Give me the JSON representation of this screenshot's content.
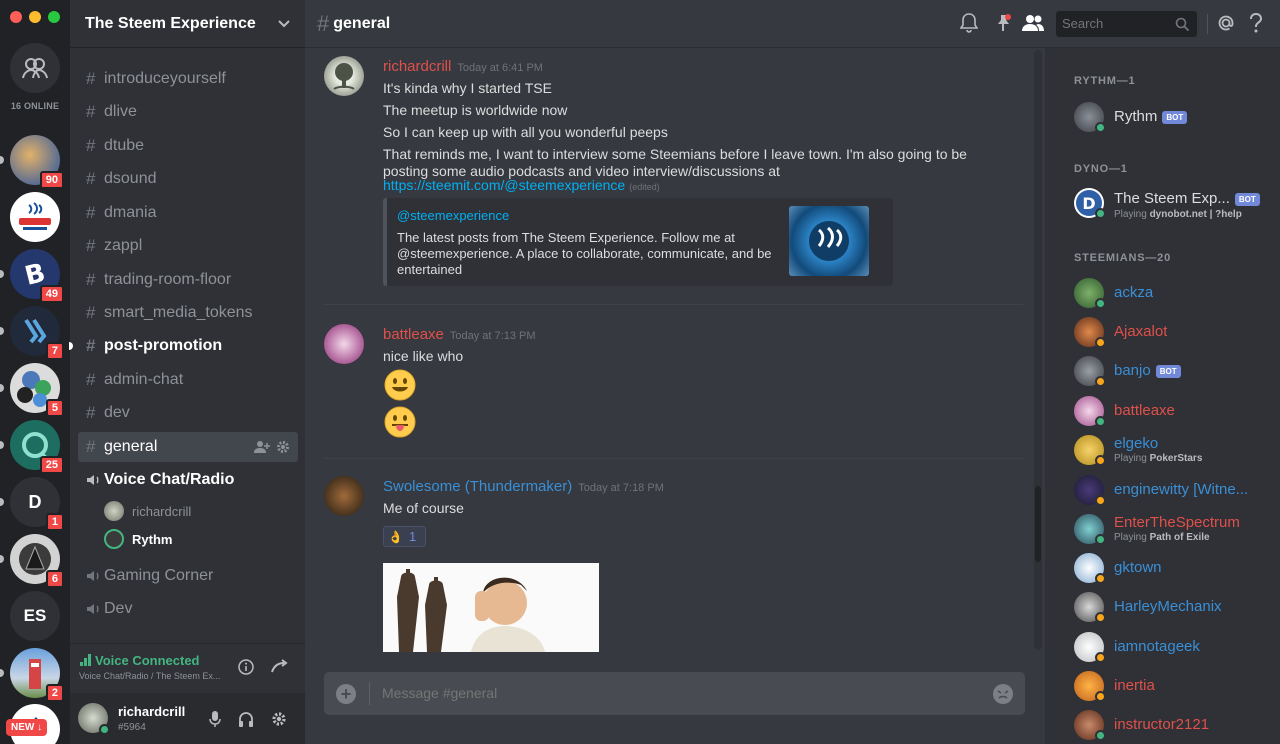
{
  "window": {
    "traffic_colors": [
      "#ff5f57",
      "#febc2e",
      "#28c840"
    ]
  },
  "guild_bar": {
    "online_count": "16 ONLINE",
    "guilds": [
      {
        "name": "server-1",
        "badge": "90",
        "color": "#6a7a9a"
      },
      {
        "name": "steemit-meetup",
        "badge": "",
        "color": "#ffffff"
      },
      {
        "name": "bitcoin",
        "badge": "49",
        "color": "#2a3f8f"
      },
      {
        "name": "bittrex",
        "badge": "7",
        "color": "#3a5d8c"
      },
      {
        "name": "crypto-mix",
        "badge": "5",
        "color": "#d9d9d9"
      },
      {
        "name": "teal-circle",
        "badge": "25",
        "color": "#1e7a6a"
      },
      {
        "name": "D",
        "badge": "1",
        "initials": "D",
        "color": "#2f3136"
      },
      {
        "name": "pyramid",
        "badge": "6",
        "color": "#cfcfcf"
      },
      {
        "name": "ES",
        "badge": "",
        "initials": "ES",
        "color": "#2f3136"
      },
      {
        "name": "blue-tower",
        "badge": "2",
        "color": "#4a7fc0"
      },
      {
        "name": "steem-new",
        "badge": "",
        "color": "#ffffff"
      }
    ],
    "new_label": "NEW ↓"
  },
  "server": {
    "name": "The Steem Experience"
  },
  "channels": [
    {
      "name": "introduceyourself",
      "state": "normal"
    },
    {
      "name": "dlive",
      "state": "normal"
    },
    {
      "name": "dtube",
      "state": "normal"
    },
    {
      "name": "dsound",
      "state": "normal"
    },
    {
      "name": "dmania",
      "state": "normal"
    },
    {
      "name": "zappl",
      "state": "normal"
    },
    {
      "name": "trading-room-floor",
      "state": "normal"
    },
    {
      "name": "smart_media_tokens",
      "state": "normal"
    },
    {
      "name": "post-promotion",
      "state": "unread"
    },
    {
      "name": "admin-chat",
      "state": "locked"
    },
    {
      "name": "dev",
      "state": "normal"
    },
    {
      "name": "general",
      "state": "active"
    }
  ],
  "voice_channels": [
    {
      "name": "Voice Chat/Radio",
      "state": "active",
      "users": [
        "richardcrill",
        "Rythm"
      ]
    },
    {
      "name": "Gaming Corner",
      "state": "normal"
    },
    {
      "name": "Dev",
      "state": "normal"
    }
  ],
  "voice_status": {
    "label": "Voice Connected",
    "sub": "Voice Chat/Radio / The Steem Ex..."
  },
  "user": {
    "name": "richardcrill",
    "tag": "#5964"
  },
  "header": {
    "channel": "general",
    "search_placeholder": "Search"
  },
  "messages": [
    {
      "author": "richardcrill",
      "author_color": "#e0504b",
      "time": "Today at 6:41 PM",
      "lines": [
        "It's kinda why I started TSE",
        "The meetup is worldwide now",
        "So I can keep up with all you wonderful peeps",
        "That reminds me, I want to interview some Steemians before I leave town. I'm also going to be posting some audio podcasts and video interview/discussions at"
      ],
      "link": "https://steemit.com/@steemexperience",
      "edited": "(edited)",
      "embed": {
        "title": "@steemexperience",
        "description": "The latest posts from The Steem Experience. Follow me at @steemexperience. A place to collaborate, communicate, and be entertained"
      }
    },
    {
      "author": "battleaxe",
      "author_color": "#e0504b",
      "time": "Today at 7:13 PM",
      "lines": [
        "nice like who"
      ],
      "emojis": [
        "😃",
        "😛"
      ]
    },
    {
      "author": "Swolesome (Thundermaker)",
      "author_color": "#3a8fd6",
      "time": "Today at 7:18 PM",
      "lines": [
        "Me of course"
      ],
      "reaction": {
        "emoji": "👌",
        "count": "1"
      }
    }
  ],
  "composer": {
    "placeholder": "Message #general"
  },
  "members": {
    "bot_label": "BOT",
    "groups": [
      {
        "title": "RYTHM—1",
        "members": [
          {
            "name": "Rythm",
            "color": "#dcddde",
            "bot": true,
            "status": "online"
          }
        ]
      },
      {
        "title": "DYNO—1",
        "members": [
          {
            "name": "The Steem Exp...",
            "color": "#dcddde",
            "bot": true,
            "status": "online",
            "activity_prefix": "Playing ",
            "activity": "dynobot.net | ?help"
          }
        ]
      },
      {
        "title": "STEEMIANS—20",
        "members": [
          {
            "name": "ackza",
            "color": "#3a8fd6",
            "status": "online"
          },
          {
            "name": "Ajaxalot",
            "color": "#e0504b",
            "status": "idle"
          },
          {
            "name": "banjo",
            "color": "#3a8fd6",
            "bot": true,
            "status": "idle"
          },
          {
            "name": "battleaxe",
            "color": "#e0504b",
            "status": "online"
          },
          {
            "name": "elgeko",
            "color": "#3a8fd6",
            "status": "idle",
            "activity_prefix": "Playing ",
            "activity": "PokerStars"
          },
          {
            "name": "enginewitty [Witne...",
            "color": "#3a8fd6",
            "status": "idle"
          },
          {
            "name": "EnterTheSpectrum",
            "color": "#e0504b",
            "status": "online",
            "activity_prefix": "Playing ",
            "activity": "Path of Exile"
          },
          {
            "name": "gktown",
            "color": "#3a8fd6",
            "status": "idle"
          },
          {
            "name": "HarleyMechanix",
            "color": "#3a8fd6",
            "status": "idle"
          },
          {
            "name": "iamnotageek",
            "color": "#3a8fd6",
            "status": "idle"
          },
          {
            "name": "inertia",
            "color": "#e0504b",
            "status": "idle"
          },
          {
            "name": "instructor2121",
            "color": "#e0504b",
            "status": "online"
          }
        ]
      }
    ]
  },
  "colors": {
    "online": "#43b581",
    "idle": "#faa61a",
    "link": "#00b0f4",
    "blurple": "#7289da"
  }
}
